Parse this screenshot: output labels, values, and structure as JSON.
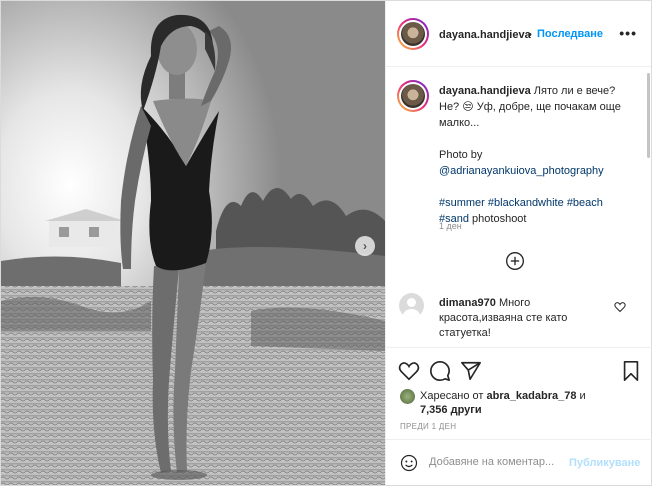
{
  "post": {
    "photo": {
      "alt": "photo-of-woman-on-beach",
      "next_arrow": "›"
    },
    "header": {
      "username": "dayana.handjieva",
      "separator": "•",
      "follow_label": "Последване",
      "more_label": "•••"
    },
    "caption": {
      "username": "dayana.handjieva",
      "text_line1": "Лято ли е вече? Не? 😒 Уф, добре, ще почакам още малко...",
      "photo_by": "Photo by",
      "photographer": "@adrianayankuiova_photography",
      "hashtags": [
        "#summer",
        "#blackandwhite",
        "#beach",
        "#sand"
      ],
      "trailing": "photoshoot",
      "time": "1 ден"
    },
    "comments": [
      {
        "username": "dimana970",
        "text": "Много красота,изваяна сте като статуетка!"
      }
    ],
    "likes": {
      "prefix": "Харесано от",
      "liker": "abra_kadabra_78",
      "conjunction": "и",
      "others": "7,356 други"
    },
    "posted_ago": "ПРЕДИ 1 ДЕН",
    "add_comment": {
      "placeholder": "Добавяне на коментар...",
      "publish_label": "Публикуване"
    },
    "icons": {
      "more": "more-icon",
      "add_comments": "plus-circle-icon",
      "comment_like": "heart-icon",
      "like": "heart-icon",
      "comment": "comment-icon",
      "share": "paper-plane-icon",
      "save": "bookmark-icon",
      "emoji": "smiley-icon"
    },
    "colors": {
      "link_blue": "#0095f6",
      "hashtag_blue": "#00376b",
      "muted": "#8e8e8e",
      "publish_disabled": "#b2dffc"
    }
  }
}
